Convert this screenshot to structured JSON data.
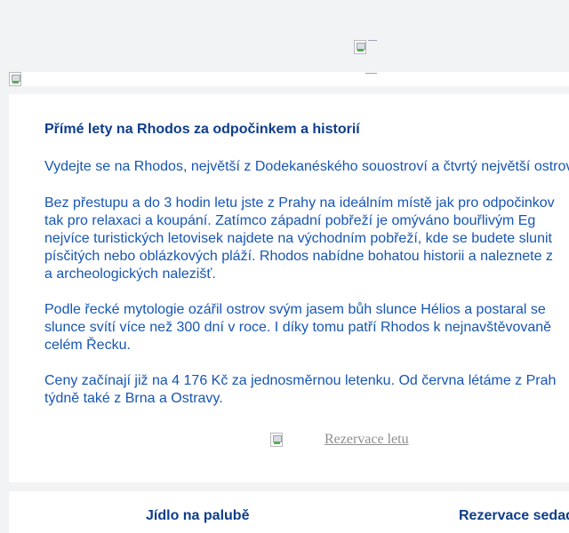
{
  "header": {
    "logo_icon": "broken-image-icon",
    "banner_icon": "broken-image-icon"
  },
  "article": {
    "title": "Přímé lety na Rhodos za odpočinkem a historií",
    "intro": "Vydejte se na Rhodos, největší z Dodekanéského souostroví a čtvrtý největší ostrov",
    "p2": [
      "Bez přestupu a do 3 hodin letu jste z Prahy na ideálním místě jak pro odpočinkov",
      "tak pro relaxaci a koupání. Zatímco západní pobřeží je omýváno bouřlivým Eg",
      "nejvíce turistických letovisek najdete na východním pobřeží, kde se budete slunit",
      "písčitých nebo oblázkových pláží. Rhodos nabídne bohatou historii a naleznete z",
      "a archeologických nalezišť."
    ],
    "p3": [
      "Podle řecké mytologie ozářil ostrov svým jasem bůh slunce Hélios a postaral se",
      "slunce svítí více než 300 dní v roce. I díky tomu patří Rhodos k nejnavštěvovaně",
      "celém Řecku."
    ],
    "p4": [
      "Ceny začínají již na 4 176 Kč za jednosměrnou letenku. Od června létáme z Prah",
      "týdně také z Brna a Ostravy."
    ],
    "cta_label": "Rezervace letu"
  },
  "features": {
    "item1": "Jídlo na palubě",
    "item2": "Rezervace sedad"
  },
  "colors": {
    "title": "#0f3d8a",
    "body_text": "#1756b4",
    "page_background": "#f2f3f5"
  }
}
